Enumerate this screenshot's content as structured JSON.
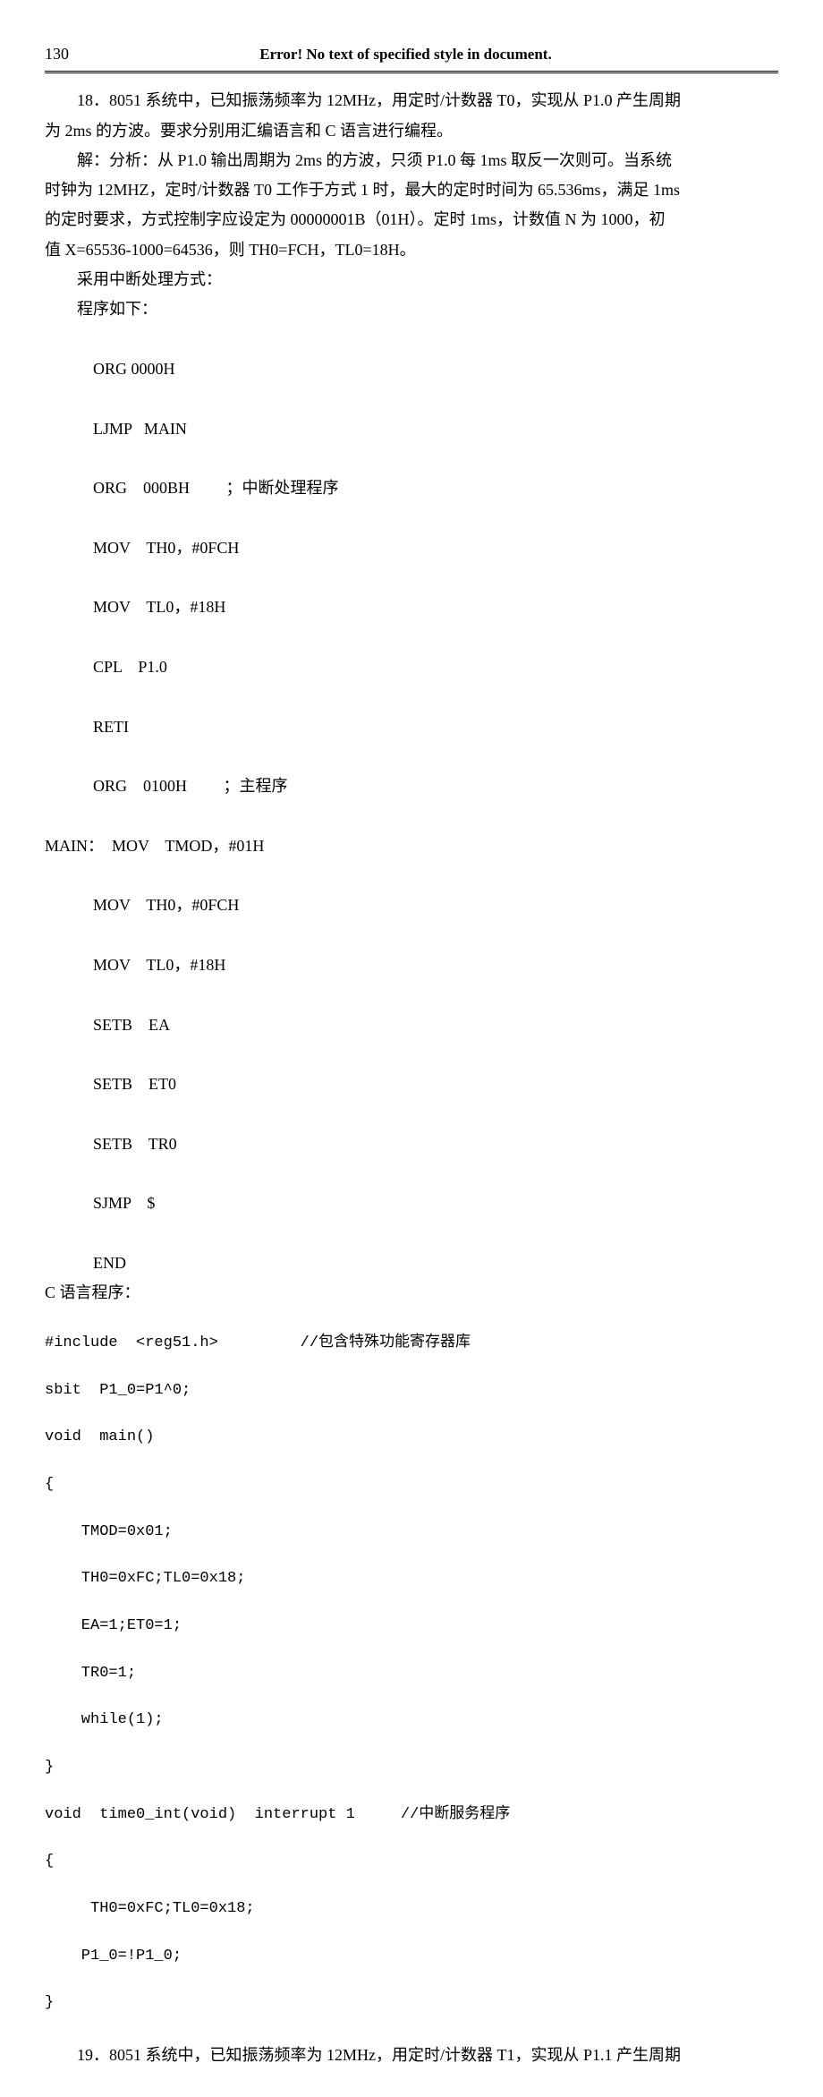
{
  "header": {
    "page_number": "130",
    "error_text": "Error! No text of specified style in document."
  },
  "body": {
    "q18_line1": "18．8051 系统中，已知振荡频率为 12MHz，用定时/计数器 T0，实现从 P1.0 产生周期",
    "q18_line2": "为 2ms 的方波。要求分别用汇编语言和 C 语言进行编程。",
    "ans_line1": "解：分析：从 P1.0 输出周期为 2ms 的方波，只须 P1.0 每 1ms 取反一次则可。当系统",
    "ans_line2": "时钟为 12MHZ，定时/计数器 T0 工作于方式 1 时，最大的定时时间为 65.536ms，满足 1ms",
    "ans_line3": "的定时要求，方式控制字应设定为 00000001B（01H）。定时 1ms，计数值 N 为 1000，初",
    "ans_line4": "值 X=65536-1000=64536，则 TH0=FCH，TL0=18H。",
    "int_mode": "采用中断处理方式：",
    "prog_label": "程序如下：",
    "asm1": "            ORG 0000H",
    "asm2": "            LJMP   MAIN",
    "asm3": "            ORG    000BH         ；中断处理程序",
    "asm4": "            MOV    TH0，#0FCH",
    "asm5": "            MOV    TL0，#18H",
    "asm6": "            CPL    P1.0",
    "asm7": "            RETI",
    "asm8": "            ORG    0100H         ；主程序",
    "asm9": "MAIN：  MOV    TMOD，#01H",
    "asm10": "            MOV    TH0，#0FCH",
    "asm11": "            MOV    TL0，#18H",
    "asm12": "            SETB    EA",
    "asm13": "            SETB    ET0",
    "asm14": "            SETB    TR0",
    "asm15": "            SJMP    $",
    "asm16": "            END",
    "c_label": "C 语言程序：",
    "c1": "#include  <reg51.h>         //包含特殊功能寄存器库",
    "c2": "sbit  P1_0=P1^0;",
    "c3": "void  main()",
    "c4": "{",
    "c5": "    TMOD=0x01;",
    "c6": "    TH0=0xFC;TL0=0x18;",
    "c7": "    EA=1;ET0=1;",
    "c8": "    TR0=1;",
    "c9": "    while(1);",
    "c10": "}",
    "c11": "void  time0_int(void)  interrupt 1     //中断服务程序",
    "c12": "{",
    "c13": "     TH0=0xFC;TL0=0x18;",
    "c14": "    P1_0=!P1_0;",
    "c15": "}",
    "q19": "19．8051 系统中，已知振荡频率为 12MHz，用定时/计数器 T1，实现从 P1.1 产生周期"
  }
}
